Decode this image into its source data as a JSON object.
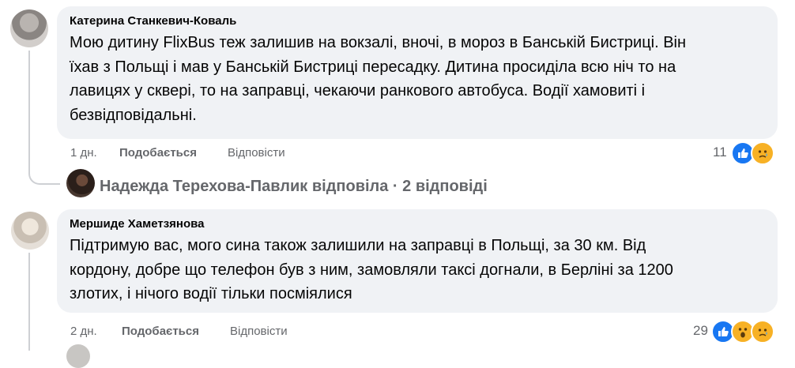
{
  "comments": [
    {
      "author": "Катерина Станкевич-Коваль",
      "text": "Мою дитину FlixBus теж залишив на вокзалі, вночі, в мороз в Банській Бистриці. Він\nїхав з Польщі і мав у Банській Бистриці пересадку. Дитина просиділа всю ніч то на\nлавицях у сквері, то на заправці, чекаючи ранкового автобуса. Водії хамовиті і\nбезвідповідальні.",
      "time": "1 дн.",
      "like": "Подобається",
      "reply": "Відповісти",
      "reaction_count": "11",
      "reactions": [
        "like-icon",
        "sad-icon"
      ]
    },
    {
      "author": "Мершиде Хаметзянова",
      "text": "Підтримую вас, мого сина також залишили на заправці в Польщі, за 30 км. Від\nкордону, добре що телефон був з ним, замовляли таксі догнали, в Берліні за 1200\nзлотих, і нічого водії тільки посміялися",
      "time": "2 дн.",
      "like": "Подобається",
      "reply": "Відповісти",
      "reaction_count": "29",
      "reactions": [
        "like-icon",
        "wow-icon",
        "sad-icon"
      ]
    }
  ],
  "replies_link": "Надежда Терехова-Павлик відповіла · 2 відповіді",
  "colors": {
    "bubble": "#f0f2f5",
    "meta": "#65676b",
    "like": "#1877f2",
    "emoji": "#f7b125"
  }
}
